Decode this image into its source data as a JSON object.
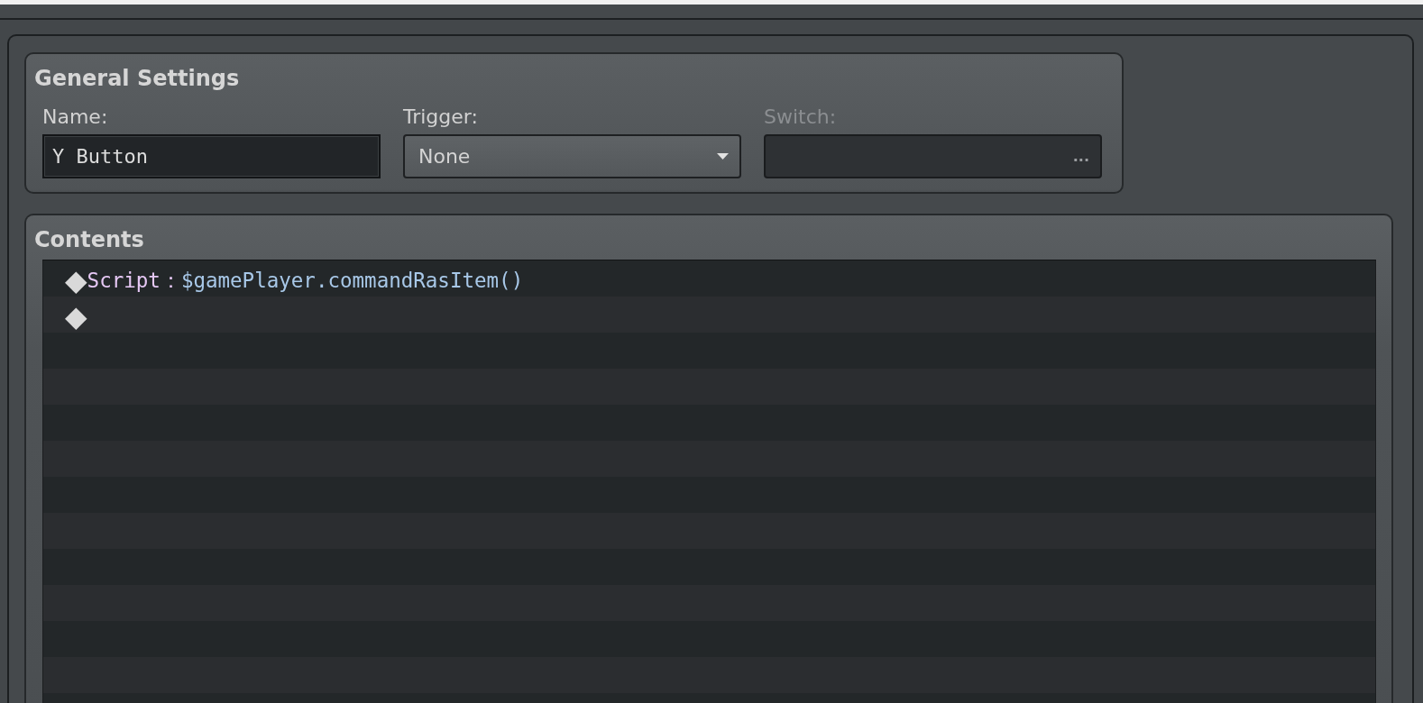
{
  "general_settings": {
    "title": "General Settings",
    "name": {
      "label": "Name:",
      "value": "Y Button"
    },
    "trigger": {
      "label": "Trigger:",
      "value": "None"
    },
    "switch": {
      "label": "Switch:",
      "button": "...",
      "disabled": true
    }
  },
  "contents": {
    "title": "Contents",
    "rows": [
      {
        "marker": "◆",
        "command": "Script：",
        "argument": "$gamePlayer.commandRasItem()"
      },
      {
        "marker": "◆"
      }
    ]
  }
}
